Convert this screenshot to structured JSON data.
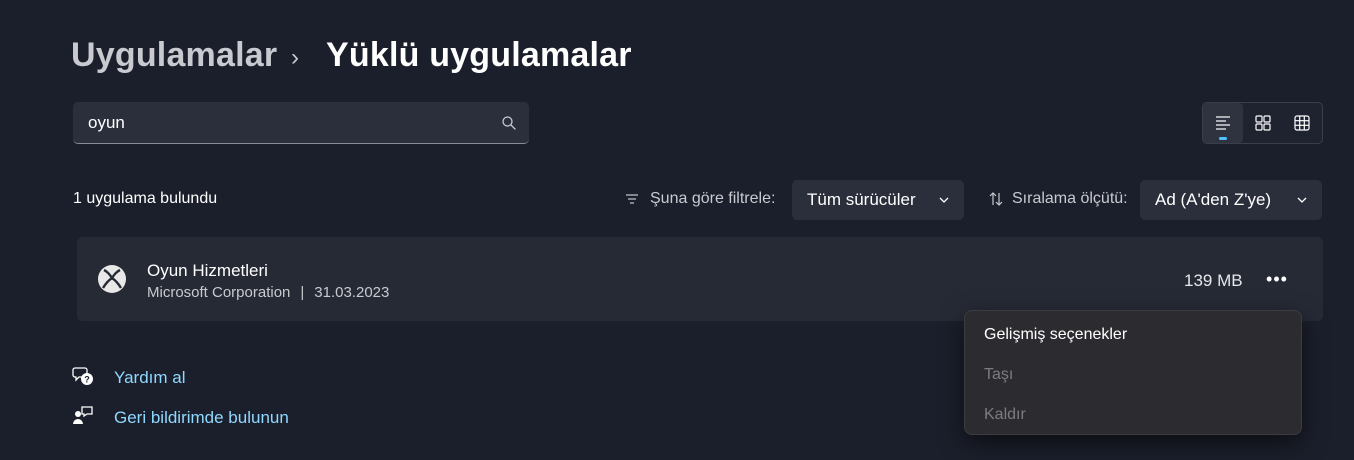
{
  "breadcrumb": {
    "parent": "Uygulamalar",
    "separator": "›",
    "current": "Yüklü uygulamalar"
  },
  "search": {
    "value": "oyun",
    "icon": "search-icon"
  },
  "view_modes": [
    {
      "icon": "list-view-icon",
      "active": true
    },
    {
      "icon": "grid-view-icon",
      "active": false
    },
    {
      "icon": "tile-view-icon",
      "active": false
    }
  ],
  "results": {
    "count_text": "1 uygulama bulundu",
    "filter_label": "Şuna göre filtrele:",
    "filter_value": "Tüm sürücüler",
    "sort_label": "Sıralama ölçütü:",
    "sort_value": "Ad (A'den Z'ye)"
  },
  "apps": [
    {
      "name": "Oyun Hizmetleri",
      "publisher": "Microsoft Corporation",
      "separator": "|",
      "date": "31.03.2023",
      "size": "139 MB",
      "more": "•••"
    }
  ],
  "links": {
    "help": "Yardım al",
    "feedback": "Geri bildirimde bulunun"
  },
  "context_menu": {
    "items": [
      {
        "label": "Gelişmiş seçenekler",
        "enabled": true
      },
      {
        "label": "Taşı",
        "enabled": false
      },
      {
        "label": "Kaldır",
        "enabled": false
      }
    ]
  },
  "colors": {
    "background": "#1b1f2b",
    "card": "#262a35",
    "accent": "#4cc2ff",
    "link": "#8fd8ff",
    "menu": "#2c2c30"
  }
}
